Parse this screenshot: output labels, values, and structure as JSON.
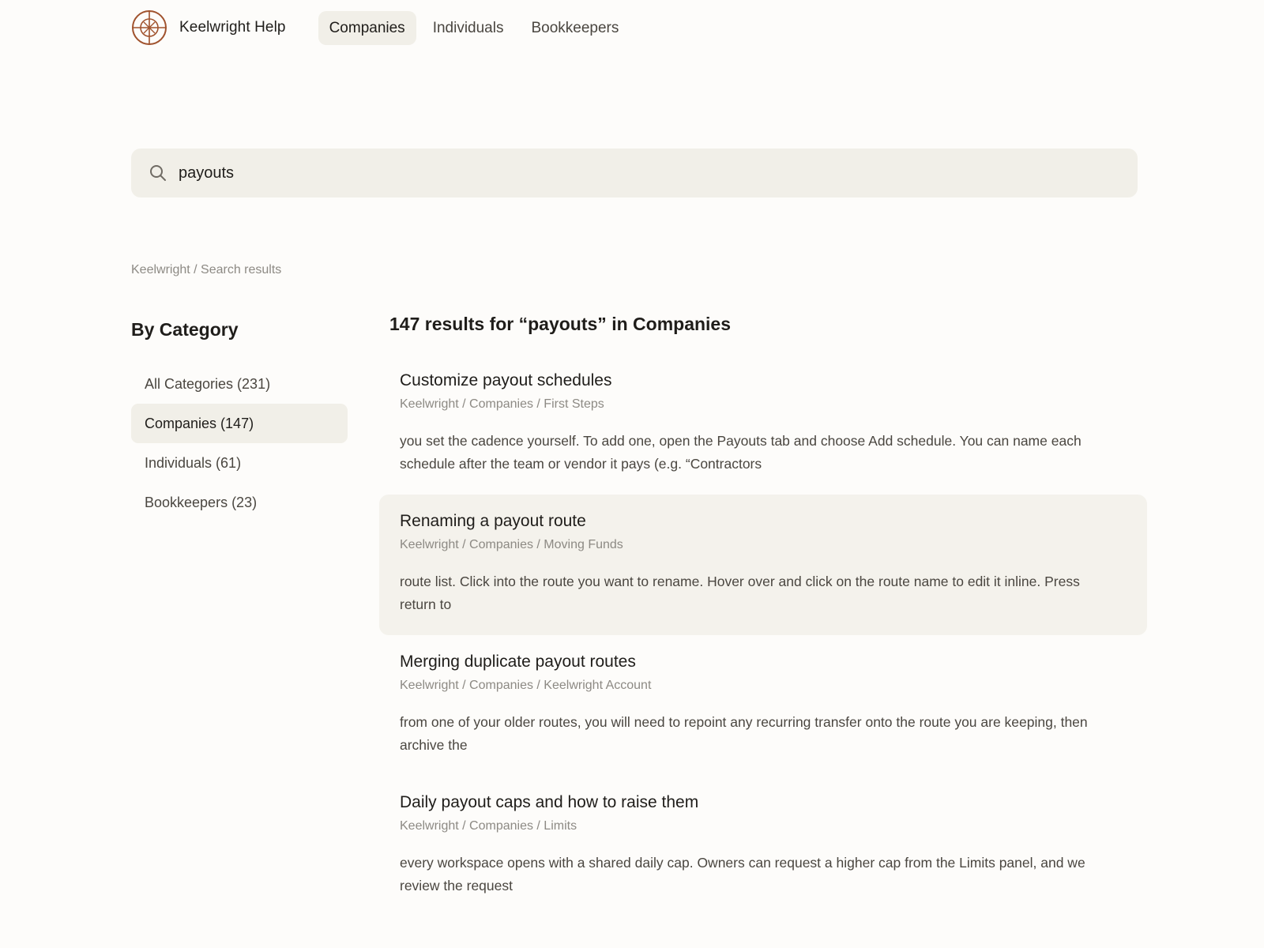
{
  "header": {
    "brand": "Keelwright Help",
    "nav": [
      {
        "label": "Companies",
        "active": true
      },
      {
        "label": "Individuals",
        "active": false
      },
      {
        "label": "Bookkeepers",
        "active": false
      }
    ],
    "logo_icon": "compass-crosshair-logo",
    "accent_color": "#a0522d"
  },
  "search": {
    "value": "payouts",
    "icon": "search-icon"
  },
  "breadcrumb": "Keelwright / Search results",
  "sidebar": {
    "title": "By Category",
    "items": [
      {
        "label": "All Categories (231)",
        "active": false
      },
      {
        "label": "Companies (147)",
        "active": true
      },
      {
        "label": "Individuals (61)",
        "active": false
      },
      {
        "label": "Bookkeepers (23)",
        "active": false
      }
    ]
  },
  "results": {
    "heading": "147 results for “payouts” in Companies",
    "items": [
      {
        "title": "Customize payout schedules",
        "path": "Keelwright / Companies / First Steps",
        "excerpt": "you set the cadence yourself. To add one, open the Payouts tab and choose Add schedule. You can name each schedule after the team or vendor it pays (e.g. “Contractors",
        "hovered": false
      },
      {
        "title": "Renaming a payout route",
        "path": "Keelwright / Companies / Moving Funds",
        "excerpt": "route list. Click into the route you want to rename. Hover over and click on the route name to edit it inline. Press return to",
        "hovered": true
      },
      {
        "title": "Merging duplicate payout routes",
        "path": "Keelwright / Companies / Keelwright Account",
        "excerpt": "from one of your older routes, you will need to repoint any recurring transfer onto the route you are keeping, then archive the",
        "hovered": false
      },
      {
        "title": "Daily payout caps and how to raise them",
        "path": "Keelwright / Companies / Limits",
        "excerpt": "every workspace opens with a shared daily cap. Owners can request a higher cap from the Limits panel, and we review the request",
        "hovered": false
      }
    ]
  }
}
